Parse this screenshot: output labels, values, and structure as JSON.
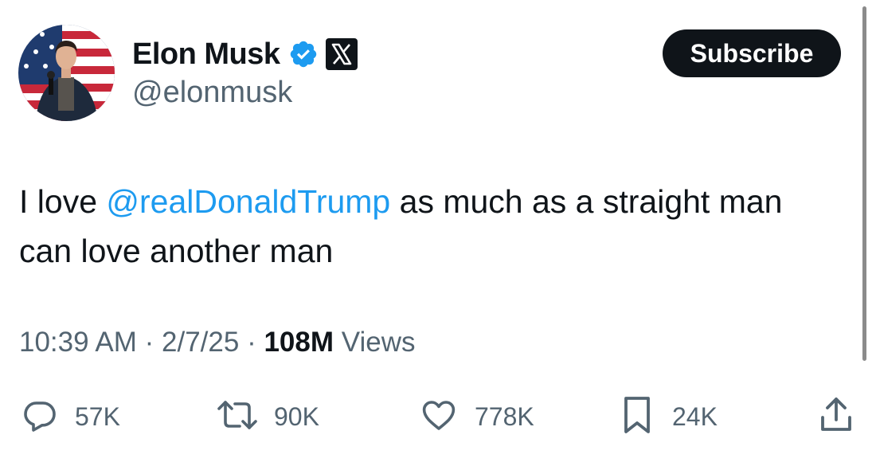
{
  "author": {
    "display_name": "Elon Musk",
    "handle": "@elonmusk",
    "verified_color": "#1d9bf0"
  },
  "header": {
    "subscribe_label": "Subscribe"
  },
  "tweet": {
    "text_before": "I love ",
    "mention": "@realDonaldTrump",
    "text_after": " as much as a straight man can love another man"
  },
  "meta": {
    "time": "10:39 AM",
    "separator": "·",
    "date": "2/7/25",
    "views_count": "108M",
    "views_label": "Views"
  },
  "actions": {
    "replies": "57K",
    "reposts": "90K",
    "likes": "778K",
    "bookmarks": "24K"
  },
  "colors": {
    "text": "#0f1419",
    "secondary": "#536471",
    "link": "#1d9bf0"
  }
}
